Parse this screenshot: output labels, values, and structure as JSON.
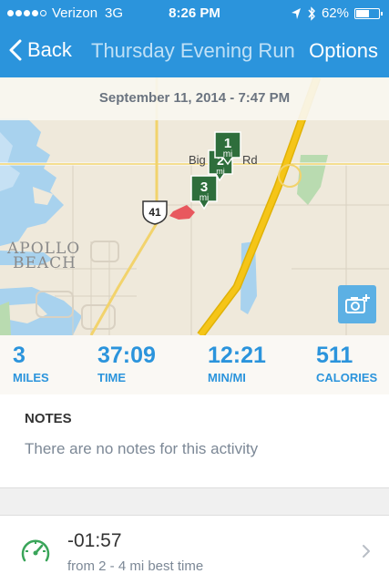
{
  "status_bar": {
    "carrier": "Verizon",
    "network": "3G",
    "time": "8:26 PM",
    "battery": "62%",
    "battery_level": 0.62
  },
  "nav": {
    "back_label": "Back",
    "title": "Thursday Evening Run",
    "options_label": "Options"
  },
  "date": "September 11, 2014 - 7:47 PM",
  "map": {
    "road_label_big": "Big",
    "road_label_rd": "Rd",
    "town_line1": "APOLLO",
    "town_line2": "BEACH",
    "route_shield": "41",
    "markers": [
      {
        "num": "1",
        "unit": "mi"
      },
      {
        "num": "2",
        "unit": "mi"
      },
      {
        "num": "3",
        "unit": "mi"
      }
    ]
  },
  "stats": [
    {
      "value": "3",
      "label": "MILES"
    },
    {
      "value": "37:09",
      "label": "TIME"
    },
    {
      "value": "12:21",
      "label": "MIN/MI"
    },
    {
      "value": "511",
      "label": "CALORIES"
    }
  ],
  "notes": {
    "title": "NOTES",
    "text": "There are no notes for this activity"
  },
  "best_time": {
    "delta": "-01:57",
    "subtitle": "from 2 - 4 mi best time"
  },
  "colors": {
    "brand": "#2b94dc",
    "marker_green": "#2e6e3c",
    "route_red": "#e8585e",
    "highway_yellow": "#f5c518",
    "water": "#a8d2ee"
  }
}
